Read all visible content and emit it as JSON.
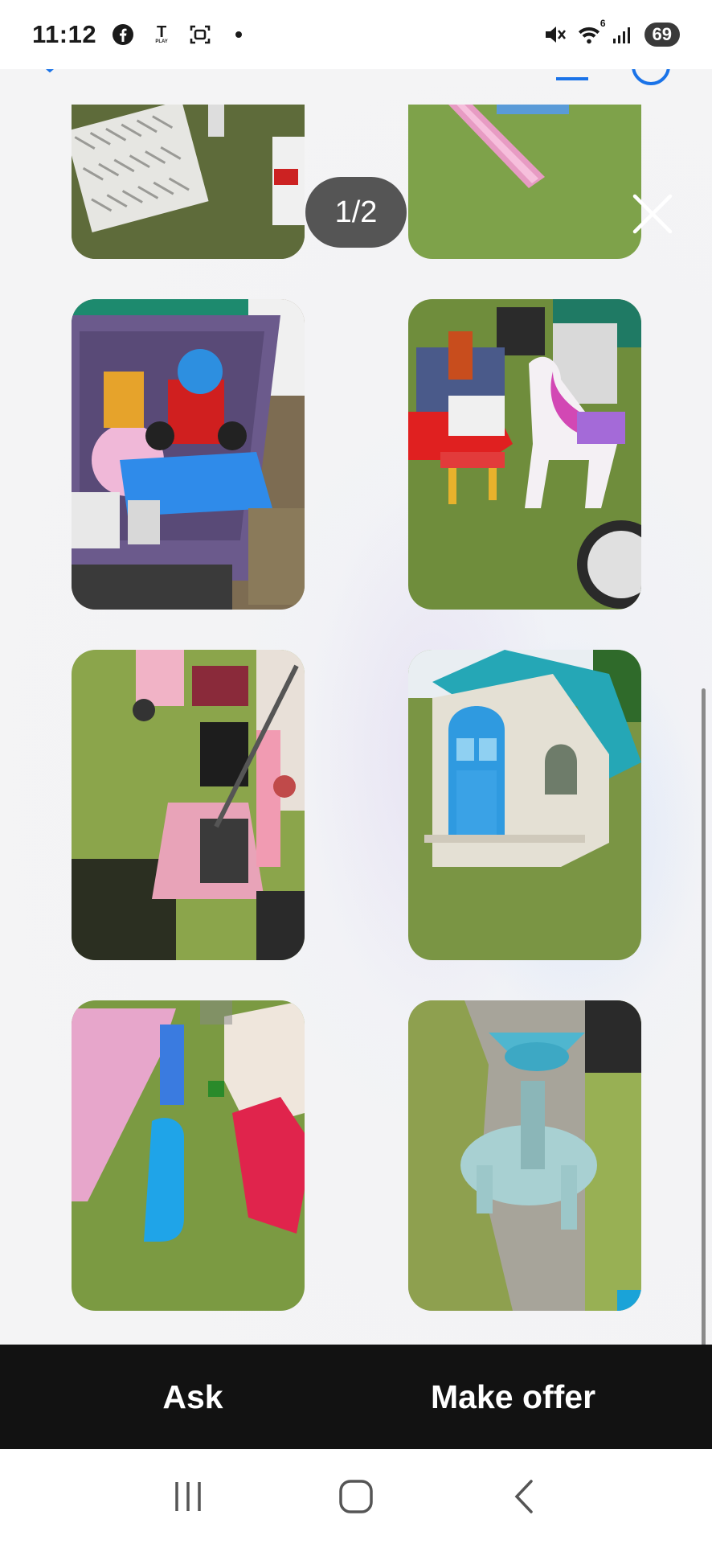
{
  "status_bar": {
    "time": "11:12",
    "left_icons": [
      "facebook-icon",
      "t-play-icon",
      "screenshot-icon",
      "dot-icon"
    ],
    "right_icons": [
      "mute-icon",
      "wifi-icon",
      "signal-icon"
    ],
    "wifi_badge": "6",
    "t_play_label": "PLAY",
    "battery": "69"
  },
  "viewer": {
    "counter": "1/2",
    "top_icons": [
      "collapse-icon",
      "download-icon",
      "more-icon"
    ],
    "photos": [
      {
        "alt": "white plastic gate on grass",
        "kind": "gate"
      },
      {
        "alt": "pink slide on grass",
        "kind": "slide"
      },
      {
        "alt": "purple bin full of toys",
        "kind": "bin"
      },
      {
        "alt": "ride-on toys and unicorn",
        "kind": "rides"
      },
      {
        "alt": "pink toy car and walker",
        "kind": "car"
      },
      {
        "alt": "plastic playhouse with blue door",
        "kind": "house"
      },
      {
        "alt": "slide, rocker and climber",
        "kind": "slides"
      },
      {
        "alt": "water table on dirt",
        "kind": "water"
      }
    ]
  },
  "actions": {
    "ask_label": "Ask",
    "offer_label": "Make offer"
  },
  "nav": {
    "items": [
      "recents-icon",
      "home-icon",
      "back-icon"
    ]
  },
  "colors": {
    "action_bar": "#121212",
    "counter_bg": "#555555",
    "accent_blue": "#1a73e8",
    "grass": "#7a9b4a"
  }
}
